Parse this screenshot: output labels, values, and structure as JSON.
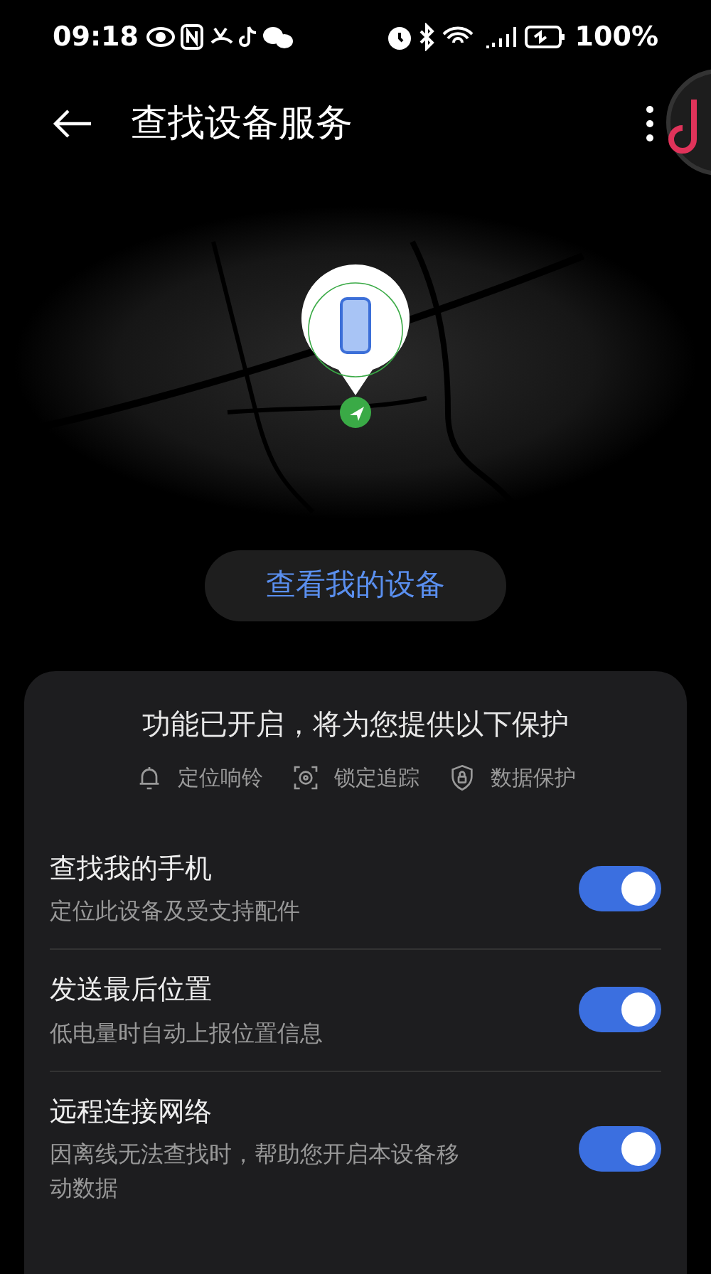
{
  "status_bar": {
    "time": "09:18",
    "battery": "100%"
  },
  "header": {
    "title": "查找设备服务"
  },
  "view_button": "查看我的设备",
  "card": {
    "heading": "功能已开启，将为您提供以下保护",
    "features": [
      {
        "kind": "bell",
        "label": "定位响铃"
      },
      {
        "kind": "target",
        "label": "锁定追踪"
      },
      {
        "kind": "shield",
        "label": "数据保护"
      }
    ],
    "settings": [
      {
        "title": "查找我的手机",
        "subtitle": "定位此设备及受支持配件",
        "on": true
      },
      {
        "title": "发送最后位置",
        "subtitle": "低电量时自动上报位置信息",
        "on": true
      },
      {
        "title": "远程连接网络",
        "subtitle": "因离线无法查找时，帮助您开启本设备移动数据",
        "on": true
      }
    ]
  }
}
